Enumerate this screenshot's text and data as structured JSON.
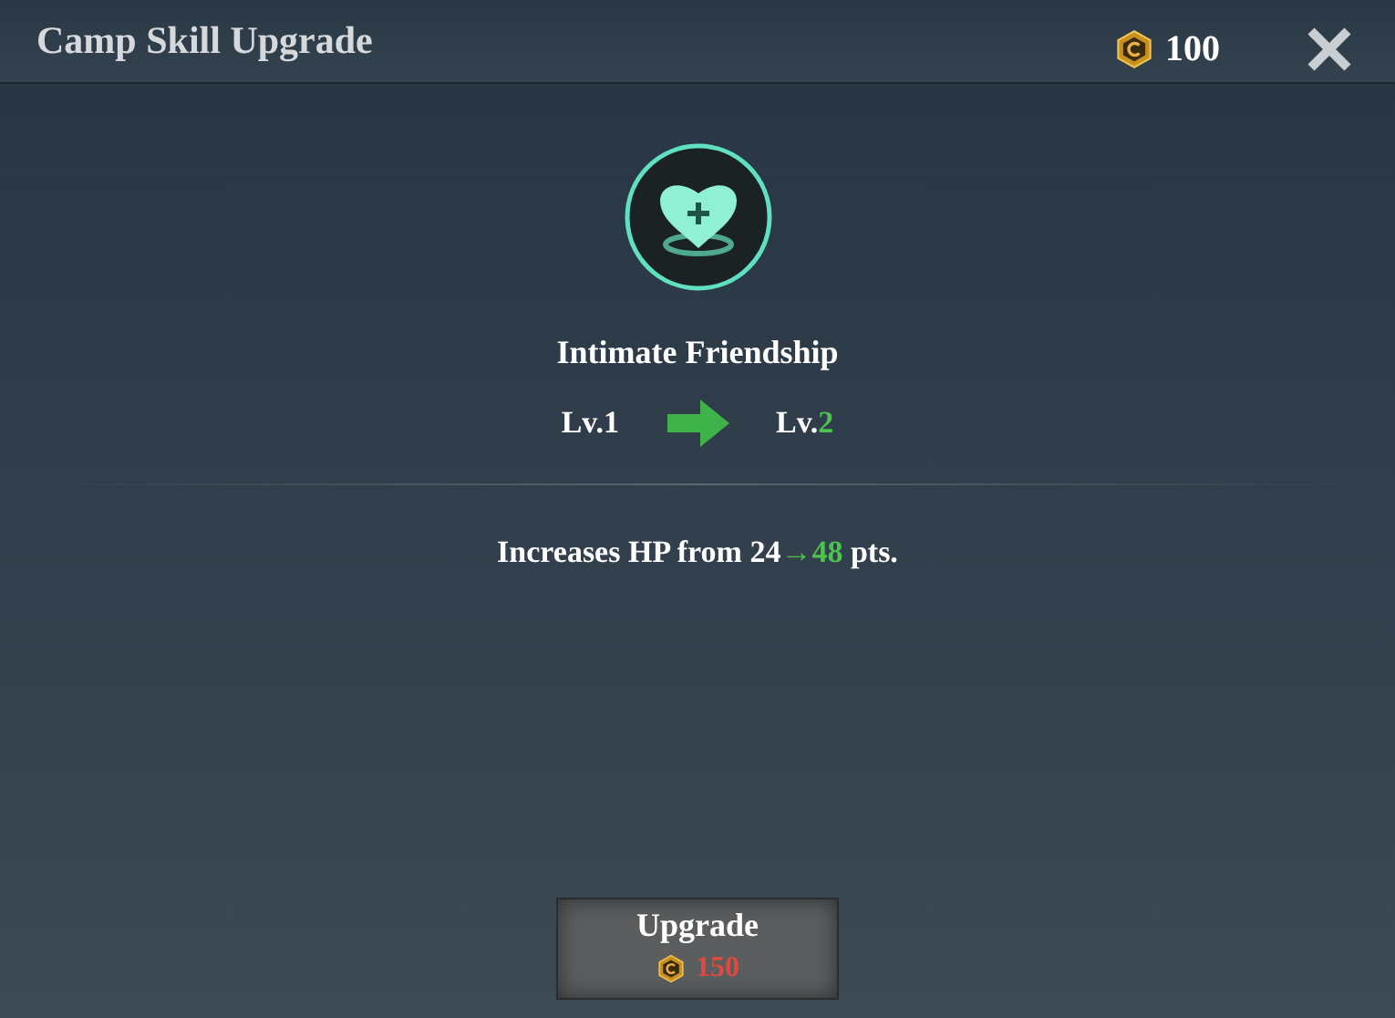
{
  "window": {
    "title": "Camp Skill Upgrade",
    "currency": "100"
  },
  "skill": {
    "name": "Intimate Friendship",
    "level_from": "Lv.1",
    "level_to_prefix": "Lv.",
    "level_to_value": "2"
  },
  "description": [
    {
      "text": "Increases HP from 24",
      "highlight": false
    },
    {
      "text": "→48",
      "highlight": true
    },
    {
      "text": " pts.",
      "highlight": false
    }
  ],
  "upgrade_button": {
    "label": "Upgrade",
    "cost": "150",
    "affordable": false
  }
}
